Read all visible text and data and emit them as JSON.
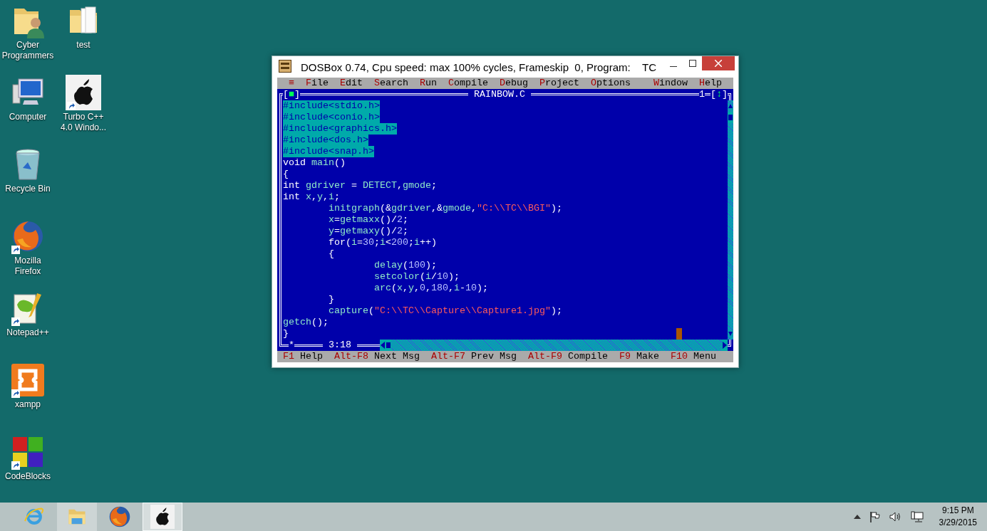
{
  "desktop_icons": [
    {
      "kind": "user-folder",
      "label": "Cyber\nProgrammers",
      "shortcut": false
    },
    {
      "kind": "computer",
      "label": "Computer",
      "shortcut": false
    },
    {
      "kind": "recycle-bin",
      "label": "Recycle Bin",
      "shortcut": false
    },
    {
      "kind": "firefox",
      "label": "Mozilla\nFirefox",
      "shortcut": true
    },
    {
      "kind": "notepad",
      "label": "Notepad++",
      "shortcut": true
    },
    {
      "kind": "xampp",
      "label": "xampp",
      "shortcut": true
    },
    {
      "kind": "codeblocks",
      "label": "CodeBlocks",
      "shortcut": true
    },
    {
      "kind": "folder",
      "label": "test",
      "shortcut": false
    },
    {
      "kind": "apple",
      "label": "Turbo C++\n4.0 Windo...",
      "shortcut": true
    }
  ],
  "window": {
    "title": "DOSBox 0.74, Cpu speed: max 100% cycles, Frameskip  0, Program:    TC"
  },
  "menu": [
    {
      "key": "≡"
    },
    {
      "key": "F",
      "rest": "ile"
    },
    {
      "key": "E",
      "rest": "dit"
    },
    {
      "key": "S",
      "rest": "earch"
    },
    {
      "key": "R",
      "rest": "un"
    },
    {
      "key": "C",
      "rest": "ompile"
    },
    {
      "key": "D",
      "rest": "ebug"
    },
    {
      "key": "P",
      "rest": "roject"
    },
    {
      "key": "O",
      "rest": "ptions"
    }
  ],
  "menu_right": [
    {
      "key": "W",
      "rest": "indow"
    },
    {
      "key": "H",
      "rest": "elp"
    }
  ],
  "editor": {
    "close_button": "[■]",
    "title": "RAINBOW.C",
    "number": "1",
    "zoom_button": "[↕]",
    "modified_mark": "*",
    "position": "3:18",
    "lines": [
      {
        "selected": true,
        "text": "#include<stdio.h>"
      },
      {
        "selected": true,
        "text": "#include<conio.h>"
      },
      {
        "selected": true,
        "text": "#include<graphics.h>"
      },
      {
        "selected": true,
        "text": "#include<dos.h>"
      },
      {
        "selected": true,
        "text": "#include<snap.h>"
      },
      {
        "selected": false,
        "tokens": [
          {
            "kind": "plain",
            "text": "void "
          },
          {
            "kind": "ident",
            "text": "main"
          },
          {
            "kind": "plain",
            "text": "()"
          }
        ]
      },
      {
        "selected": false,
        "tokens": [
          {
            "kind": "plain",
            "text": "{"
          }
        ]
      },
      {
        "selected": false,
        "tokens": [
          {
            "kind": "plain",
            "text": "int "
          },
          {
            "kind": "ident",
            "text": "gdriver"
          },
          {
            "kind": "plain",
            "text": " = "
          },
          {
            "kind": "ident",
            "text": "DETECT"
          },
          {
            "kind": "plain",
            "text": ","
          },
          {
            "kind": "ident",
            "text": "gmode"
          },
          {
            "kind": "plain",
            "text": ";"
          }
        ]
      },
      {
        "selected": false,
        "tokens": [
          {
            "kind": "plain",
            "text": "int "
          },
          {
            "kind": "ident",
            "text": "x"
          },
          {
            "kind": "plain",
            "text": ","
          },
          {
            "kind": "ident",
            "text": "y"
          },
          {
            "kind": "plain",
            "text": ","
          },
          {
            "kind": "ident",
            "text": "i"
          },
          {
            "kind": "plain",
            "text": ";"
          }
        ],
        "children": [
          {
            "selected": false,
            "tokens": [
              {
                "kind": "ident",
                "text": "initgraph"
              },
              {
                "kind": "plain",
                "text": "(&"
              },
              {
                "kind": "ident",
                "text": "gdriver"
              },
              {
                "kind": "plain",
                "text": ",&"
              },
              {
                "kind": "ident",
                "text": "gmode"
              },
              {
                "kind": "plain",
                "text": ","
              },
              {
                "kind": "string",
                "text": "\"C:\\\\TC\\\\BGI\""
              },
              {
                "kind": "plain",
                "text": ");"
              }
            ]
          },
          {
            "selected": false,
            "tokens": [
              {
                "kind": "ident",
                "text": "x"
              },
              {
                "kind": "plain",
                "text": "="
              },
              {
                "kind": "ident",
                "text": "getmaxx"
              },
              {
                "kind": "plain",
                "text": "()/"
              },
              {
                "kind": "number",
                "text": "2"
              },
              {
                "kind": "plain",
                "text": ";"
              }
            ]
          },
          {
            "selected": false,
            "tokens": [
              {
                "kind": "ident",
                "text": "y"
              },
              {
                "kind": "plain",
                "text": "="
              },
              {
                "kind": "ident",
                "text": "getmaxy"
              },
              {
                "kind": "plain",
                "text": "()/"
              },
              {
                "kind": "number",
                "text": "2"
              },
              {
                "kind": "plain",
                "text": ";"
              }
            ]
          },
          {
            "selected": false,
            "tokens": [
              {
                "kind": "plain",
                "text": "for("
              },
              {
                "kind": "ident",
                "text": "i"
              },
              {
                "kind": "plain",
                "text": "="
              },
              {
                "kind": "number",
                "text": "30"
              },
              {
                "kind": "plain",
                "text": ";"
              },
              {
                "kind": "ident",
                "text": "i"
              },
              {
                "kind": "plain",
                "text": "<"
              },
              {
                "kind": "number",
                "text": "200"
              },
              {
                "kind": "plain",
                "text": ";"
              },
              {
                "kind": "ident",
                "text": "i"
              },
              {
                "kind": "plain",
                "text": "++)"
              }
            ]
          },
          {
            "selected": false,
            "tokens": [
              {
                "kind": "plain",
                "text": "{"
              }
            ],
            "children": [
              {
                "selected": false,
                "tokens": [
                  {
                    "kind": "ident",
                    "text": "delay"
                  },
                  {
                    "kind": "plain",
                    "text": "("
                  },
                  {
                    "kind": "number",
                    "text": "100"
                  },
                  {
                    "kind": "plain",
                    "text": ");"
                  }
                ]
              },
              {
                "selected": false,
                "tokens": [
                  {
                    "kind": "ident",
                    "text": "setcolor"
                  },
                  {
                    "kind": "plain",
                    "text": "("
                  },
                  {
                    "kind": "ident",
                    "text": "i"
                  },
                  {
                    "kind": "plain",
                    "text": "/"
                  },
                  {
                    "kind": "number",
                    "text": "10"
                  },
                  {
                    "kind": "plain",
                    "text": ");"
                  }
                ]
              },
              {
                "selected": false,
                "tokens": [
                  {
                    "kind": "ident",
                    "text": "arc"
                  },
                  {
                    "kind": "plain",
                    "text": "("
                  },
                  {
                    "kind": "ident",
                    "text": "x"
                  },
                  {
                    "kind": "plain",
                    "text": ","
                  },
                  {
                    "kind": "ident",
                    "text": "y"
                  },
                  {
                    "kind": "plain",
                    "text": ","
                  },
                  {
                    "kind": "number",
                    "text": "0"
                  },
                  {
                    "kind": "plain",
                    "text": ","
                  },
                  {
                    "kind": "number",
                    "text": "180"
                  },
                  {
                    "kind": "plain",
                    "text": ","
                  },
                  {
                    "kind": "ident",
                    "text": "i"
                  },
                  {
                    "kind": "plain",
                    "text": "-"
                  },
                  {
                    "kind": "number",
                    "text": "10"
                  },
                  {
                    "kind": "plain",
                    "text": ");"
                  }
                ]
              }
            ]
          },
          {
            "selected": false,
            "tokens": [
              {
                "kind": "plain",
                "text": "}"
              }
            ]
          },
          {
            "selected": false,
            "tokens": [
              {
                "kind": "ident",
                "text": "capture"
              },
              {
                "kind": "plain",
                "text": "("
              },
              {
                "kind": "string",
                "text": "\"C:\\\\TC\\\\Capture\\\\Capture1.jpg\""
              },
              {
                "kind": "plain",
                "text": ");"
              }
            ]
          }
        ]
      },
      {
        "selected": false,
        "tokens": [
          {
            "kind": "ident",
            "text": "getch"
          },
          {
            "kind": "plain",
            "text": "();"
          }
        ]
      },
      {
        "selected": false,
        "tokens": [
          {
            "kind": "plain",
            "text": "}"
          }
        ]
      }
    ]
  },
  "status_bar": [
    {
      "key": "F1",
      "label": "Help"
    },
    {
      "key": "Alt-F8",
      "label": "Next Msg"
    },
    {
      "key": "Alt-F7",
      "label": "Prev Msg"
    },
    {
      "key": "Alt-F9",
      "label": "Compile"
    },
    {
      "key": "F9",
      "label": "Make"
    },
    {
      "key": "F10",
      "label": "Menu"
    }
  ],
  "taskbar": [
    {
      "kind": "ie",
      "highlighted": false,
      "selected": false
    },
    {
      "kind": "explorer",
      "highlighted": true,
      "selected": false
    },
    {
      "kind": "firefox",
      "highlighted": false,
      "selected": false
    },
    {
      "kind": "apple",
      "highlighted": true,
      "selected": true
    }
  ],
  "clock": {
    "time": "9:15 PM",
    "date": "3/29/2015"
  }
}
